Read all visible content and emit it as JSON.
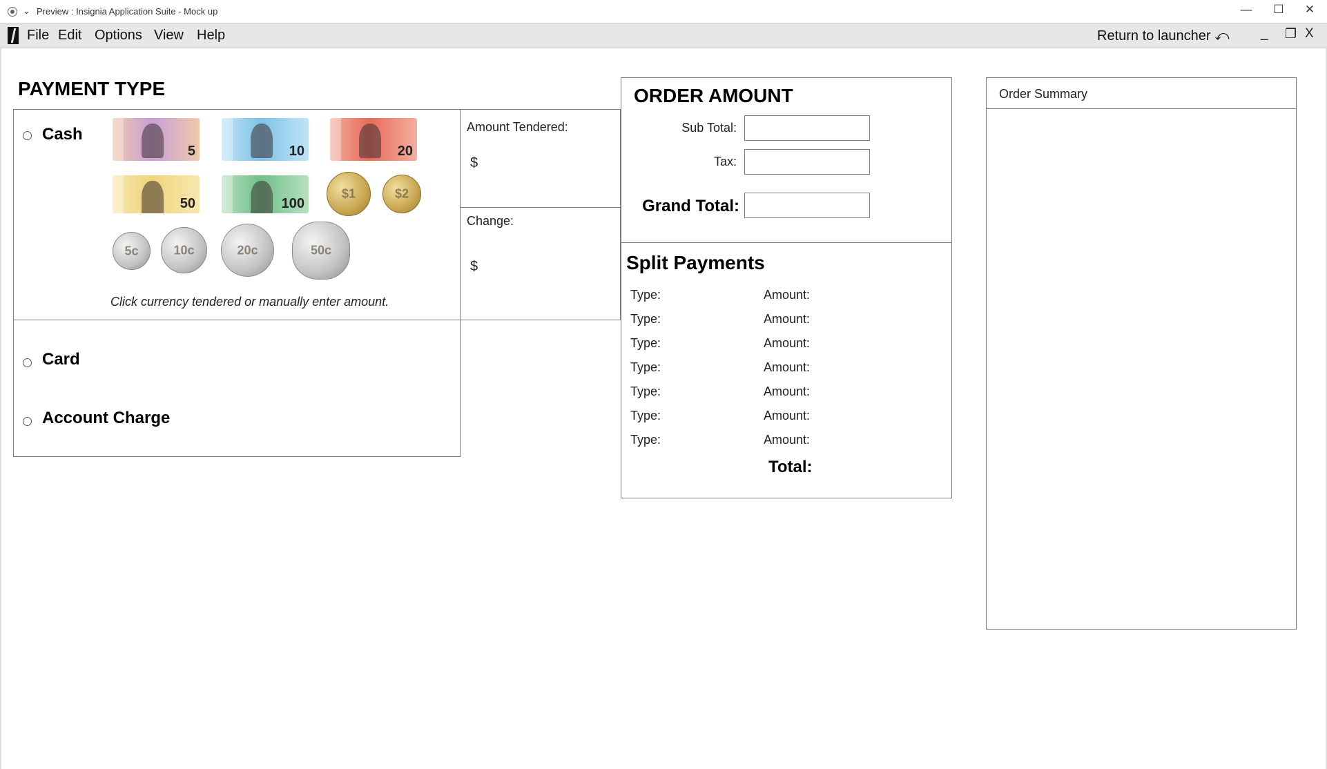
{
  "window": {
    "title": "Preview : Insignia Application Suite - Mock up",
    "minimize_icon": "minimize-icon",
    "maximize_icon": "maximize-icon",
    "close_icon": "close-icon"
  },
  "menubar": {
    "items": [
      "File",
      "Edit",
      "Options",
      "View",
      "Help"
    ],
    "return_label": "Return to launcher",
    "return_icon": "undo-arrow-icon",
    "minimize": "_",
    "restore": "❐",
    "close": "X"
  },
  "payment": {
    "heading": "PAYMENT TYPE",
    "options": {
      "cash": "Cash",
      "card": "Card",
      "account": "Account Charge"
    },
    "notes": [
      {
        "value": "5",
        "color_a": "#c9a0d8",
        "color_b": "#f0c8a8"
      },
      {
        "value": "10",
        "color_a": "#7fc3e8",
        "color_b": "#bfe3f5"
      },
      {
        "value": "20",
        "color_a": "#e86a5a",
        "color_b": "#f3b0a0"
      },
      {
        "value": "50",
        "color_a": "#f0d47a",
        "color_b": "#f7e8b0"
      },
      {
        "value": "100",
        "color_a": "#6fbf8a",
        "color_b": "#b8e0c0"
      }
    ],
    "coins": [
      {
        "value": "$1",
        "metal": "gold"
      },
      {
        "value": "$2",
        "metal": "gold"
      },
      {
        "value": "5c",
        "metal": "silver"
      },
      {
        "value": "10c",
        "metal": "silver"
      },
      {
        "value": "20c",
        "metal": "silver"
      },
      {
        "value": "50c",
        "metal": "silver"
      }
    ],
    "instruction": "Click currency tendered or manually enter amount.",
    "amount_tendered_label": "Amount Tendered:",
    "amount_tendered_symbol": "$",
    "change_label": "Change:",
    "change_symbol": "$"
  },
  "order": {
    "heading": "ORDER AMOUNT",
    "subtotal_label": "Sub Total:",
    "tax_label": "Tax:",
    "grand_total_label": "Grand Total:",
    "split_heading": "Split Payments",
    "split_rows": [
      {
        "type": "Type:",
        "amount": "Amount:"
      },
      {
        "type": "Type:",
        "amount": "Amount:"
      },
      {
        "type": "Type:",
        "amount": "Amount:"
      },
      {
        "type": "Type:",
        "amount": "Amount:"
      },
      {
        "type": "Type:",
        "amount": "Amount:"
      },
      {
        "type": "Type:",
        "amount": "Amount:"
      },
      {
        "type": "Type:",
        "amount": "Amount:"
      }
    ],
    "total_label": "Total:"
  },
  "summary": {
    "title": "Order Summary"
  }
}
